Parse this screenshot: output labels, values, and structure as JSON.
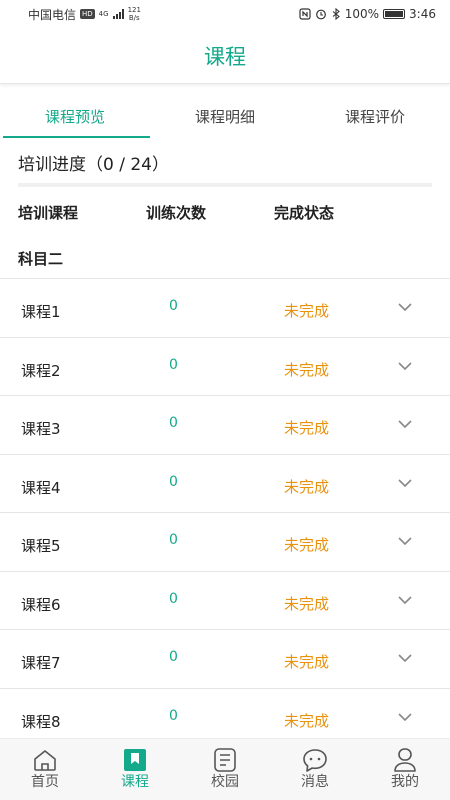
{
  "status_bar": {
    "carrier": "中国电信",
    "hd": "HD",
    "signal_type": "4G",
    "speed_value": "121",
    "speed_unit": "B/s",
    "battery_percent": "100%",
    "time": "3:46"
  },
  "header": {
    "title": "课程"
  },
  "tabs": [
    {
      "label": "课程预览",
      "active": true
    },
    {
      "label": "课程明细",
      "active": false
    },
    {
      "label": "课程评价",
      "active": false
    }
  ],
  "progress": {
    "text": "培训进度（0 / 24）"
  },
  "columns": [
    "培训课程",
    "训练次数",
    "完成状态"
  ],
  "subject": "科目二",
  "rows": [
    {
      "name": "课程1",
      "count": "0",
      "status": "未完成"
    },
    {
      "name": "课程2",
      "count": "0",
      "status": "未完成"
    },
    {
      "name": "课程3",
      "count": "0",
      "status": "未完成"
    },
    {
      "name": "课程4",
      "count": "0",
      "status": "未完成"
    },
    {
      "name": "课程5",
      "count": "0",
      "status": "未完成"
    },
    {
      "name": "课程6",
      "count": "0",
      "status": "未完成"
    },
    {
      "name": "课程7",
      "count": "0",
      "status": "未完成"
    },
    {
      "name": "课程8",
      "count": "0",
      "status": "未完成"
    }
  ],
  "bottom_nav": [
    {
      "label": "首页",
      "icon": "home-icon",
      "active": false
    },
    {
      "label": "课程",
      "icon": "bookmark-icon",
      "active": true
    },
    {
      "label": "校园",
      "icon": "document-icon",
      "active": false
    },
    {
      "label": "消息",
      "icon": "message-icon",
      "active": false
    },
    {
      "label": "我的",
      "icon": "profile-icon",
      "active": false
    }
  ],
  "colors": {
    "accent": "#14a98b",
    "pending": "#e8920e"
  }
}
